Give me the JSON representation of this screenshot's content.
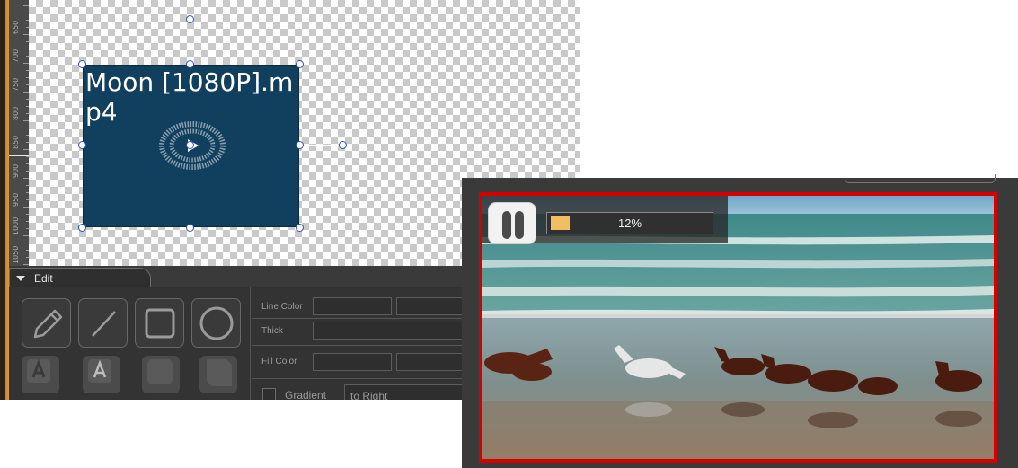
{
  "editor": {
    "ruler_labels": [
      "650",
      "700",
      "750",
      "800",
      "850",
      "900",
      "950",
      "1000",
      "1050"
    ],
    "media_item": {
      "title": "Moon [1080P].mp4",
      "icon": "play-icon",
      "fill_color": "#11405e"
    },
    "edit_panel": {
      "tab_label": "Edit",
      "tools": [
        {
          "name": "pencil-tool",
          "icon": "pencil-icon"
        },
        {
          "name": "line-tool",
          "icon": "line-icon"
        },
        {
          "name": "rectangle-tool",
          "icon": "square-icon"
        },
        {
          "name": "ellipse-tool",
          "icon": "circle-icon"
        }
      ],
      "properties": {
        "line_color_label": "Line Color",
        "thick_label": "Thick",
        "fill_color_label": "Fill Color",
        "gradient_label": "Gradient",
        "gradient_direction": "to Right"
      }
    },
    "colors": {
      "accent": "#d99a3e",
      "handle_border": "#3550c8"
    }
  },
  "player": {
    "progress_text": "12%",
    "progress_fraction": 0.12,
    "pause_icon": "pause-icon",
    "colors": {
      "frame_border": "#d40000",
      "progress_fill": "#f0c060"
    }
  }
}
